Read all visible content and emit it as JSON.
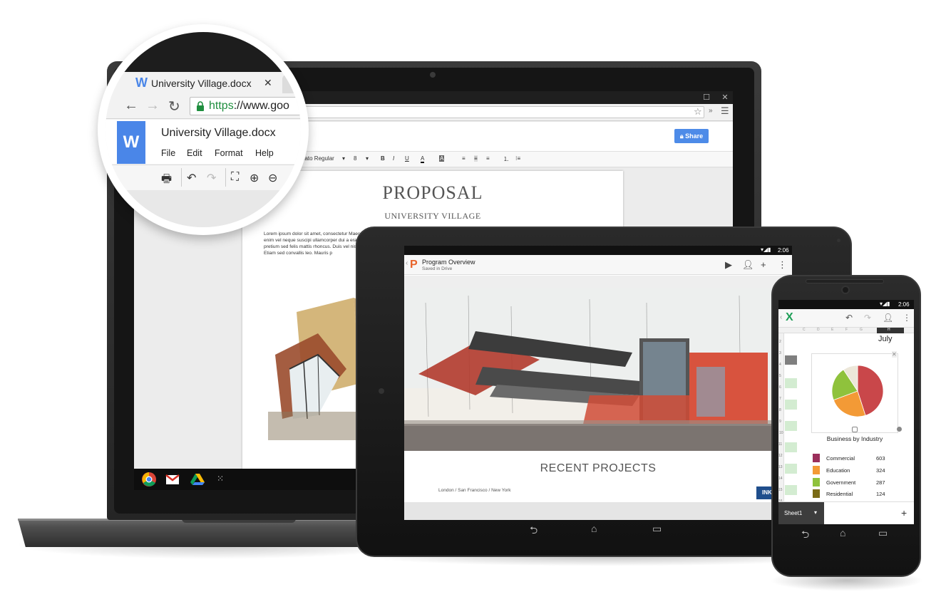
{
  "laptop": {
    "window_controls": {
      "maximize": "☐",
      "close": "✕"
    },
    "omnibox_star": "☆",
    "overflow_glyph": "»",
    "menu_glyph": "☰",
    "share_label": "Share",
    "toolbar": {
      "font_name": "Lato Regular",
      "font_size": "8",
      "bold": "B",
      "italic": "I",
      "underline": "U",
      "text_color": "A",
      "highlight": "A"
    },
    "doc": {
      "title": "PROPOSAL",
      "subtitle": "UNIVERSITY VILLAGE",
      "body": "Lorem ipsum dolor sit amet, consectetur Maecenas vitae enim vel neque suscipi ullamcorper dui a erat ultrices, pretium sed felis mattis rhoncus. Duis vel nisi m Mauris. Etiam sed convallis leo. Mauris p"
    },
    "shelf_apps": [
      "chrome-icon",
      "gmail-icon",
      "drive-icon",
      "apps-grid-icon"
    ]
  },
  "zoom": {
    "tab_logo": "W",
    "tab_title": "University Village.docx",
    "tab_close": "✕",
    "url_scheme": "https",
    "url_rest": "://www.goo",
    "doc_logo": "W",
    "doc_title": "University Village.docx",
    "menu": [
      "File",
      "Edit",
      "Format",
      "Help"
    ],
    "nav_icons": {
      "back": "←",
      "forward": "→",
      "reload": "↻"
    }
  },
  "tablet": {
    "time": "2:06",
    "app_logo": "P",
    "title": "Program Overview",
    "subtitle": "Saved in Drive",
    "slide_heading": "RECENT PROJECTS",
    "slide_cities": "London /  San Francisco / New York",
    "slide_brand": "INK",
    "nav": {
      "back": "⮌",
      "home": "⌂",
      "recents": "▭"
    }
  },
  "phone": {
    "time": "2:06",
    "app_logo": "X",
    "chart_header": "July",
    "sheet_tab": "Sheet1",
    "add_sheet": "+",
    "legend_heading": "Business by Industry",
    "legend": [
      {
        "label": "Commercial",
        "value": "603",
        "color": "#9b2f5b"
      },
      {
        "label": "Education",
        "value": "324",
        "color": "#f39a36"
      },
      {
        "label": "Government",
        "value": "287",
        "color": "#8fc23c"
      },
      {
        "label": "Residential",
        "value": "124",
        "color": "#7a6b16"
      }
    ],
    "row_numbers": [
      "2",
      "3",
      "4",
      "5",
      "6",
      "7",
      "8",
      "9",
      "10",
      "11",
      "12",
      "13",
      "14",
      "15",
      "16"
    ],
    "col_letters": [
      "C",
      "D",
      "E",
      "F",
      "G",
      "H"
    ]
  },
  "chart_data": {
    "type": "pie",
    "title": "Business by Industry",
    "categories": [
      "Commercial",
      "Education",
      "Government",
      "Residential"
    ],
    "values": [
      603,
      324,
      287,
      124
    ],
    "colors": [
      "#c9474a",
      "#f39a36",
      "#8fc23c",
      "#ece7d9"
    ]
  }
}
